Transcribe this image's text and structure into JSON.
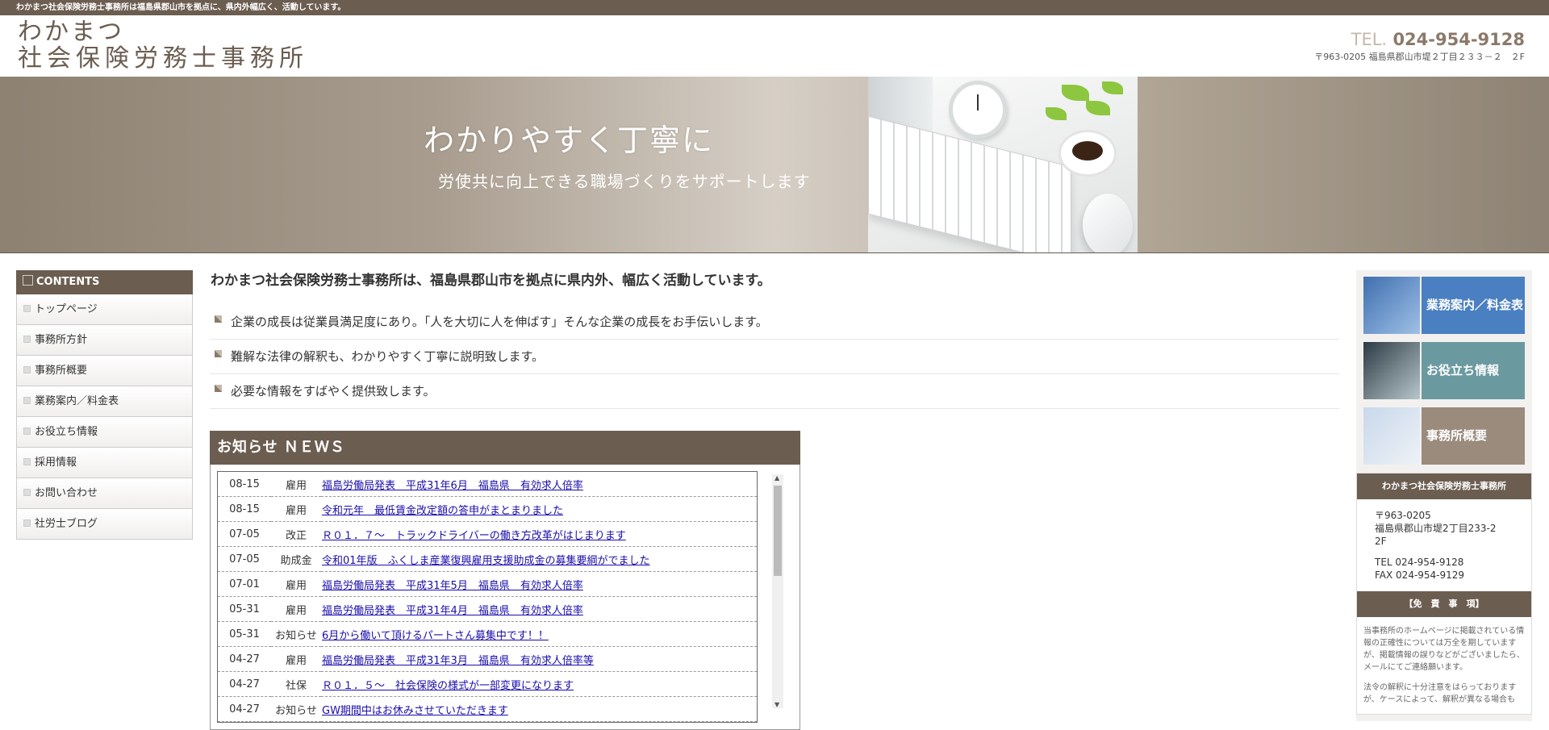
{
  "topbar": {
    "text": "わかまつ社会保険労務士事務所は福島県郡山市を拠点に、県内外幅広く、活動しています。"
  },
  "logo": {
    "line1": "わかまつ",
    "line2": "社会保険労務士事務所"
  },
  "contact": {
    "tel_prefix": "TEL.",
    "tel": "024-954-9128",
    "address": "〒963-0205 福島県郡山市堤２丁目２３３－２　２F"
  },
  "hero": {
    "headline": "わかりやすく丁寧に",
    "subline": "労使共に向上できる職場づくりをサポートします"
  },
  "nav": {
    "title": "CONTENTS",
    "items": [
      "トップページ",
      "事務所方針",
      "事務所概要",
      "業務案内／料金表",
      "お役立ち情報",
      "採用情報",
      "お問い合わせ",
      "社労士ブログ"
    ]
  },
  "main": {
    "intro": "わかまつ社会保険労務士事務所は、福島県郡山市を拠点に県内外、幅広く活動しています。",
    "points": [
      "企業の成長は従業員満足度にあり。「人を大切に人を伸ばす」そんな企業の成長をお手伝いします。",
      "難解な法律の解釈も、わかりやすく丁寧に説明致します。",
      "必要な情報をすばやく提供致します。"
    ]
  },
  "news": {
    "title": "お知らせ ＮＥＷＳ",
    "rows": [
      {
        "date": "08-15",
        "cat": "雇用",
        "title": "福島労働局発表　平成31年6月　福島県　有効求人倍率"
      },
      {
        "date": "08-15",
        "cat": "雇用",
        "title": "令和元年　最低賃金改定額の答申がまとまりました"
      },
      {
        "date": "07-05",
        "cat": "改正",
        "title": "Ｒ０１．７～　トラックドライバーの働き方改革がはじまります"
      },
      {
        "date": "07-05",
        "cat": "助成金",
        "title": "令和01年版　ふくしま産業復興雇用支援助成金の募集要綱がでました"
      },
      {
        "date": "07-01",
        "cat": "雇用",
        "title": "福島労働局発表　平成31年5月　福島県　有効求人倍率"
      },
      {
        "date": "05-31",
        "cat": "雇用",
        "title": "福島労働局発表　平成31年4月　福島県　有効求人倍率"
      },
      {
        "date": "05-31",
        "cat": "お知らせ",
        "title": "6月から働いて頂けるパートさん募集中です！！"
      },
      {
        "date": "04-27",
        "cat": "雇用",
        "title": "福島労働局発表　平成31年3月　福島県　有効求人倍率等"
      },
      {
        "date": "04-27",
        "cat": "社保",
        "title": "Ｒ０１．５～　社会保険の様式が一部変更になります"
      },
      {
        "date": "04-27",
        "cat": "お知らせ",
        "title": "GW期間中はお休みさせていただきます"
      }
    ]
  },
  "sidebar": {
    "banners": [
      {
        "label": "業務案内／料金表",
        "color": "#4a7fc1"
      },
      {
        "label": "お役立ち情報",
        "color": "#6a9aa0"
      },
      {
        "label": "事務所概要",
        "color": "#9a8b7d"
      }
    ],
    "office": {
      "title": "わかまつ社会保険労務士事務所",
      "postal": "〒963-0205",
      "addr1": "福島県郡山市堤2丁目233-2",
      "addr2": "2F",
      "tel": "TEL 024-954-9128",
      "fax": "FAX 024-954-9129"
    },
    "disclaimer": {
      "title": "【免　責　事　項】",
      "text": "当事務所のホームページに掲載されている情報の正確性については万全を期していますが、掲載情報の誤りなどがございましたら、メールにてご連絡願います。",
      "text2": "法令の解釈に十分注意をはらっておりますが、ケースによって、解釈が異なる場合も"
    }
  }
}
